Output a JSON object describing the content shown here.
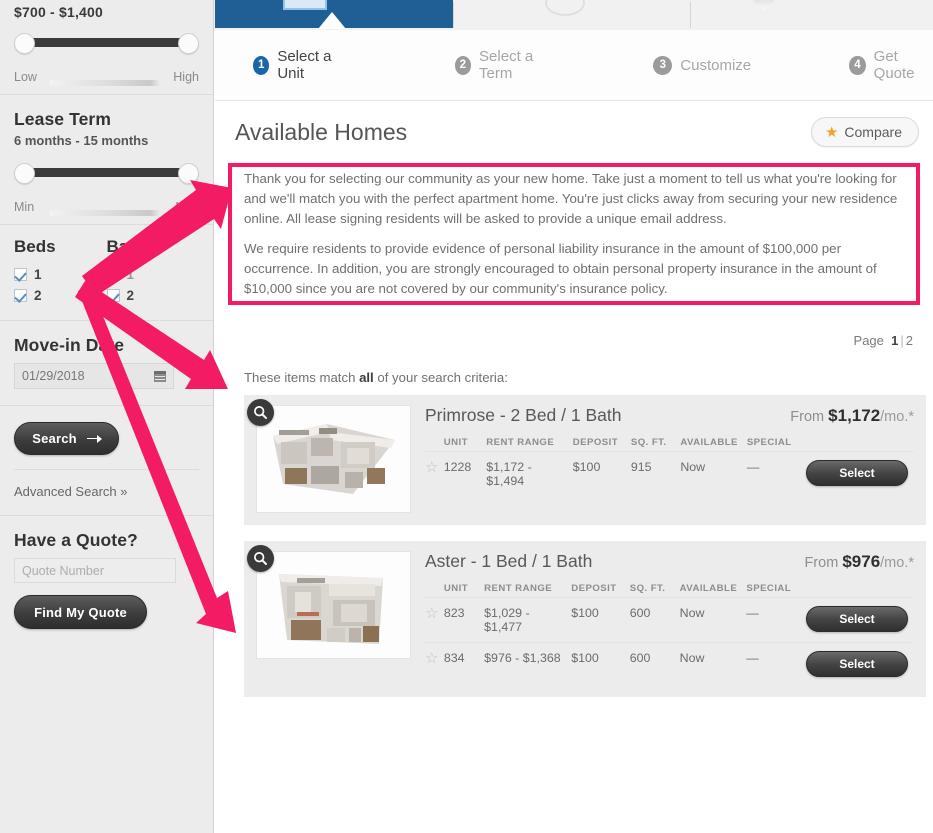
{
  "sidebar": {
    "price": {
      "value_label": "$700 - $1,400",
      "low_label": "Low",
      "high_label": "High"
    },
    "lease_term": {
      "title": "Lease Term",
      "value_label": "6 months - 15 months",
      "min_label": "Min",
      "max_label": "Max"
    },
    "beds": {
      "title": "Beds",
      "options": [
        {
          "label": "1",
          "checked": true
        },
        {
          "label": "2",
          "checked": true
        }
      ]
    },
    "baths": {
      "title": "Baths",
      "options": [
        {
          "label": "1",
          "checked": false
        },
        {
          "label": "2",
          "checked": true
        }
      ]
    },
    "movein": {
      "title": "Move-in Date",
      "value": "01/29/2018",
      "icon": "calendar-icon"
    },
    "search_button": "Search",
    "advanced_search": "Advanced Search »",
    "quote": {
      "title": "Have a Quote?",
      "placeholder": "Quote Number",
      "value": "",
      "button": "Find My Quote"
    }
  },
  "steps": [
    {
      "num": "1",
      "label": "Select a Unit",
      "active": true
    },
    {
      "num": "2",
      "label": "Select a Term",
      "active": false
    },
    {
      "num": "3",
      "label": "Customize",
      "active": false
    },
    {
      "num": "4",
      "label": "Get Quote",
      "active": false
    }
  ],
  "header": {
    "title": "Available Homes",
    "compare_label": "Compare",
    "compare_icon": "star-icon"
  },
  "notice": {
    "paragraph_1": "Thank you for selecting our community as your new home. Take just a moment to tell us what you're looking for and we'll match you with the perfect apartment home. You're just clicks away from securing your new residence online. All lease signing residents will be asked to provide a unique email address.",
    "paragraph_2": "We require residents to provide evidence of personal liability insurance in the amount of $100,000 per occurrence. In addition, you are strongly encouraged to obtain personal property insurance in the amount of $10,000 since you are not covered by our community's insurance policy."
  },
  "pager": {
    "label": "Page",
    "current": "1",
    "separator": "|",
    "next": "2"
  },
  "match_line": {
    "prefix": "These items match ",
    "emphasis": "all",
    "suffix": " of your search criteria:"
  },
  "table_headers": [
    "UNIT",
    "RENT RANGE",
    "DEPOSIT",
    "SQ. FT.",
    "AVAILABLE",
    "SPECIAL"
  ],
  "listings": [
    {
      "name": "Primrose - 2 Bed / 1 Bath",
      "from_label": "From",
      "price": "$1,172",
      "price_suffix": "/mo.*",
      "thumb_icon": "magnifier-icon",
      "rows": [
        {
          "favorite_icon": "star-outline-icon",
          "unit": "1228",
          "rent_range": "$1,172 - $1,494",
          "deposit": "$100",
          "sqft": "915",
          "available": "Now",
          "special": "—",
          "select_label": "Select"
        }
      ]
    },
    {
      "name": "Aster - 1 Bed / 1 Bath",
      "from_label": "From",
      "price": "$976",
      "price_suffix": "/mo.*",
      "thumb_icon": "magnifier-icon",
      "rows": [
        {
          "favorite_icon": "star-outline-icon",
          "unit": "823",
          "rent_range": "$1,029 - $1,477",
          "deposit": "$100",
          "sqft": "600",
          "available": "Now",
          "special": "—",
          "select_label": "Select"
        },
        {
          "favorite_icon": "star-outline-icon",
          "unit": "834",
          "rent_range": "$976 - $1,368",
          "deposit": "$100",
          "sqft": "600",
          "available": "Now",
          "special": "—",
          "select_label": "Select"
        }
      ]
    }
  ],
  "annotation": {
    "color": "#f31b63",
    "highlight_target": "notice-panel"
  }
}
